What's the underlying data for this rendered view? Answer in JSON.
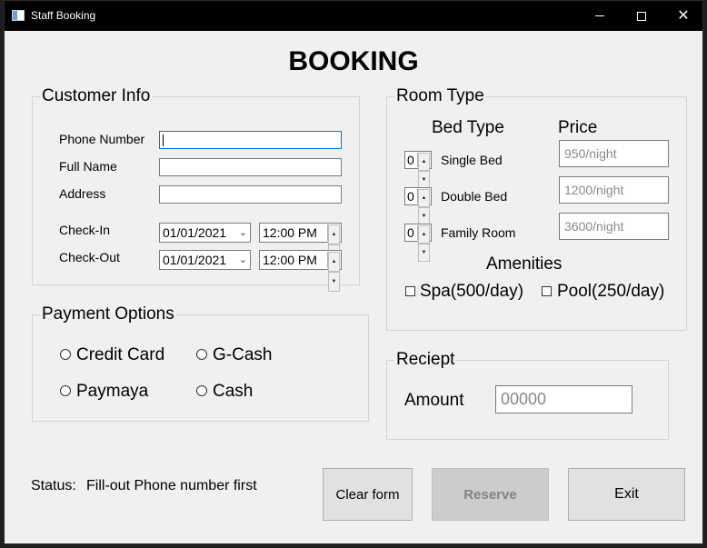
{
  "window": {
    "title": "Staff Booking",
    "minimize_glyph": "",
    "close_glyph": "✕"
  },
  "main": {
    "title": "BOOKING"
  },
  "customer_info": {
    "title": "Customer Info",
    "phone_label": "Phone Number",
    "phone_value": "",
    "fullname_label": "Full Name",
    "fullname_value": "",
    "address_label": "Address",
    "address_value": "",
    "checkin_label": "Check-In",
    "checkin_date": "01/01/2021",
    "checkin_time": "12:00 PM",
    "checkout_label": "Check-Out",
    "checkout_date": "01/01/2021",
    "checkout_time": "12:00 PM",
    "dropdown_glyph": "⌄"
  },
  "room_type": {
    "title": "Room Type",
    "bed_type_header": "Bed Type",
    "price_header": "Price",
    "rooms": [
      {
        "count": "0",
        "label": "Single Bed",
        "price": "950/night"
      },
      {
        "count": "0",
        "label": "Double Bed",
        "price": "1200/night"
      },
      {
        "count": "0",
        "label": "Family Room",
        "price": "3600/night"
      }
    ],
    "amenities_header": "Amenities",
    "spa_label": "Spa(500/day)",
    "pool_label": "Pool(250/day)",
    "spa_checked": false,
    "pool_checked": false
  },
  "payment": {
    "title": "Payment Options",
    "options": [
      "Credit Card",
      "G-Cash",
      "Paymaya",
      "Cash"
    ]
  },
  "receipt": {
    "title": "Reciept",
    "amount_label": "Amount",
    "amount_value": "00000"
  },
  "status": {
    "label": "Status:",
    "text": "Fill-out Phone number first"
  },
  "buttons": {
    "clear": "Clear form",
    "reserve": "Reserve",
    "exit": "Exit"
  },
  "icons": {
    "app": "window-app-icon",
    "minimize": "minimize-icon",
    "maximize": "maximize-icon",
    "close": "close-icon",
    "dropdown": "chevron-down-icon",
    "spin": "spin-arrows-icon"
  },
  "colors": {
    "titlebar": "#000000",
    "window_bg": "#f0f0f0",
    "focus_border": "#0078d7",
    "disabled_button_bg": "#cccccc"
  }
}
